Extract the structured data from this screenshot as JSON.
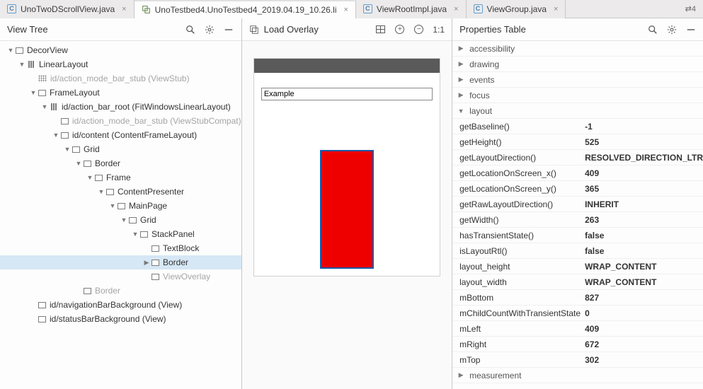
{
  "tabs": {
    "items": [
      {
        "label": "UnoTwoDScrollView.java",
        "icon": "j",
        "active": false
      },
      {
        "label": "UnoTestbed4.UnoTestbed4_2019.04.19_10.26.li",
        "icon": "li",
        "active": true
      },
      {
        "label": "ViewRootImpl.java",
        "icon": "j",
        "active": false
      },
      {
        "label": "ViewGroup.java",
        "icon": "j",
        "active": false
      }
    ],
    "rightIndicator": "⇄4"
  },
  "panels": {
    "left": {
      "title": "View Tree"
    },
    "mid": {
      "title": "Load Overlay",
      "ratio": "1:1"
    },
    "right": {
      "title": "Properties Table"
    }
  },
  "tree": [
    {
      "d": 0,
      "tw": "down",
      "icon": "rect",
      "label": "DecorView"
    },
    {
      "d": 1,
      "tw": "down",
      "icon": "vbars",
      "label": "LinearLayout"
    },
    {
      "d": 2,
      "tw": "",
      "icon": "dots",
      "label": "id/action_mode_bar_stub (ViewStub)",
      "dim": true
    },
    {
      "d": 2,
      "tw": "down",
      "icon": "rect",
      "label": "FrameLayout"
    },
    {
      "d": 3,
      "tw": "down",
      "icon": "vbars",
      "label": "id/action_bar_root (FitWindowsLinearLayout)"
    },
    {
      "d": 4,
      "tw": "",
      "icon": "rect",
      "label": "id/action_mode_bar_stub (ViewStubCompat)",
      "dim": true
    },
    {
      "d": 4,
      "tw": "down",
      "icon": "rect",
      "label": "id/content (ContentFrameLayout)"
    },
    {
      "d": 5,
      "tw": "down",
      "icon": "rect",
      "label": "Grid"
    },
    {
      "d": 6,
      "tw": "down",
      "icon": "rect",
      "label": "Border"
    },
    {
      "d": 7,
      "tw": "down",
      "icon": "rect",
      "label": "Frame"
    },
    {
      "d": 8,
      "tw": "down",
      "icon": "rect",
      "label": "ContentPresenter"
    },
    {
      "d": 9,
      "tw": "down",
      "icon": "rect",
      "label": "MainPage"
    },
    {
      "d": 10,
      "tw": "down",
      "icon": "rect",
      "label": "Grid"
    },
    {
      "d": 11,
      "tw": "down",
      "icon": "rect",
      "label": "StackPanel"
    },
    {
      "d": 12,
      "tw": "",
      "icon": "rect",
      "label": "TextBlock"
    },
    {
      "d": 12,
      "tw": "right",
      "icon": "rect",
      "label": "Border",
      "sel": true
    },
    {
      "d": 12,
      "tw": "",
      "icon": "rect",
      "label": "ViewOverlay",
      "dim": true
    },
    {
      "d": 6,
      "tw": "",
      "icon": "rect",
      "label": "Border",
      "dim": true
    },
    {
      "d": 2,
      "tw": "",
      "icon": "rect",
      "label": "id/navigationBarBackground (View)"
    },
    {
      "d": 2,
      "tw": "",
      "icon": "rect",
      "label": "id/statusBarBackground (View)"
    }
  ],
  "overlay": {
    "inputValue": "Example"
  },
  "props": {
    "groups": [
      {
        "label": "accessibility",
        "expanded": false
      },
      {
        "label": "drawing",
        "expanded": false
      },
      {
        "label": "events",
        "expanded": false
      },
      {
        "label": "focus",
        "expanded": false
      },
      {
        "label": "layout",
        "expanded": true
      },
      {
        "label": "measurement",
        "expanded": false
      }
    ],
    "layout": [
      {
        "k": "getBaseline()",
        "v": "-1"
      },
      {
        "k": "getHeight()",
        "v": "525"
      },
      {
        "k": "getLayoutDirection()",
        "v": "RESOLVED_DIRECTION_LTR"
      },
      {
        "k": "getLocationOnScreen_x()",
        "v": "409"
      },
      {
        "k": "getLocationOnScreen_y()",
        "v": "365"
      },
      {
        "k": "getRawLayoutDirection()",
        "v": "INHERIT"
      },
      {
        "k": "getWidth()",
        "v": "263"
      },
      {
        "k": "hasTransientState()",
        "v": "false"
      },
      {
        "k": "isLayoutRtl()",
        "v": "false"
      },
      {
        "k": "layout_height",
        "v": "WRAP_CONTENT"
      },
      {
        "k": "layout_width",
        "v": "WRAP_CONTENT"
      },
      {
        "k": "mBottom",
        "v": "827"
      },
      {
        "k": "mChildCountWithTransientState",
        "v": "0"
      },
      {
        "k": "mLeft",
        "v": "409"
      },
      {
        "k": "mRight",
        "v": "672"
      },
      {
        "k": "mTop",
        "v": "302"
      }
    ]
  }
}
